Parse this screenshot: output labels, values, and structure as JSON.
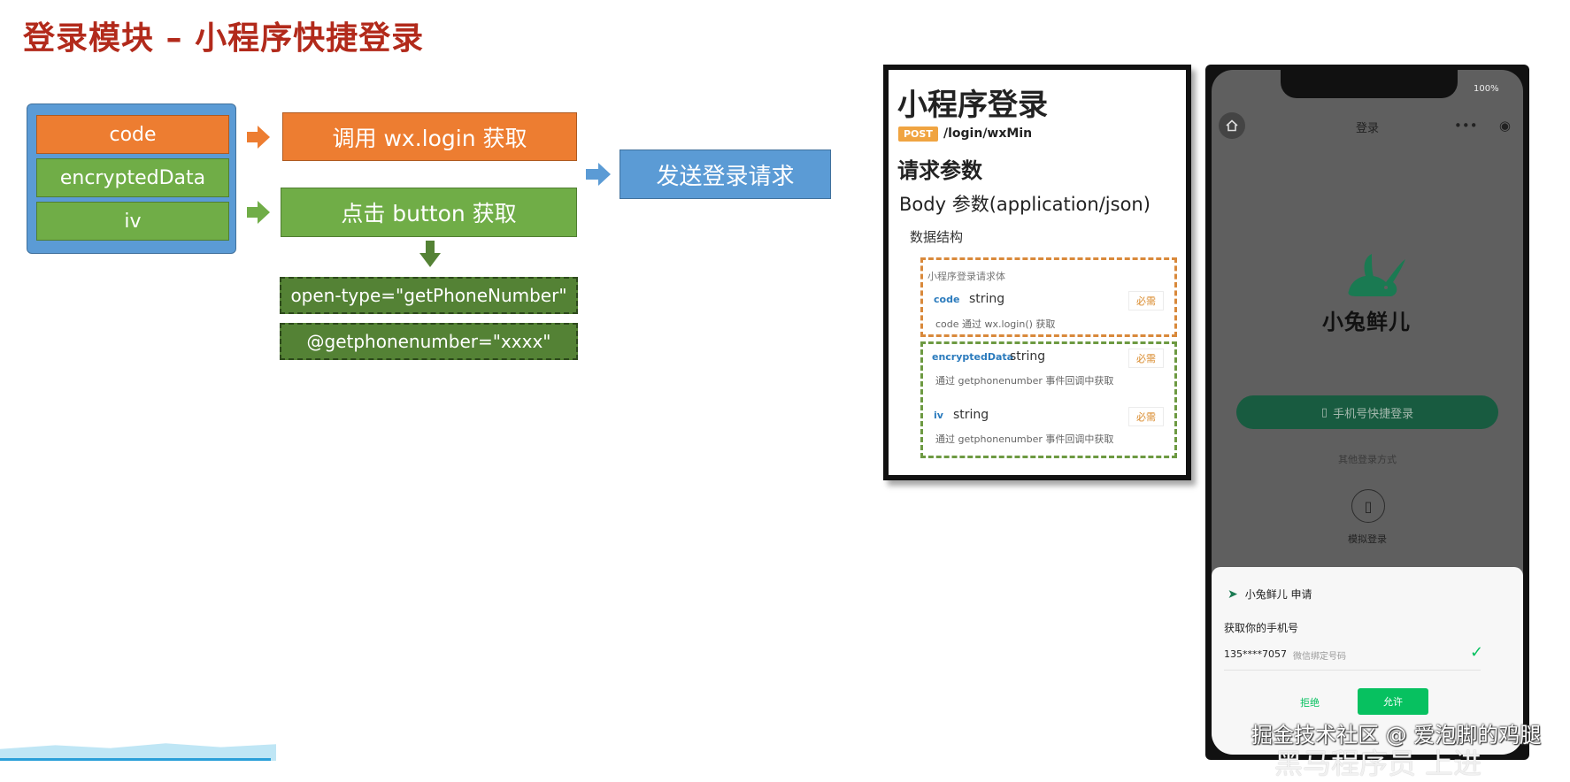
{
  "slide": {
    "title": "登录模块 – 小程序快捷登录"
  },
  "params": {
    "items": [
      "code",
      "encryptedData",
      "iv"
    ]
  },
  "flow": {
    "wx_login": "调用 wx.login 获取",
    "button_get": "点击 button 获取",
    "send_request": "发送登录请求",
    "open_type": "open-type=\"getPhoneNumber\"",
    "event_binding": "@getphonenumber=\"xxxx\""
  },
  "api_doc": {
    "title": "小程序登录",
    "method": "POST",
    "path": "/login/wxMin",
    "params_heading": "请求参数",
    "body_heading": "Body 参数(application/json)",
    "data_structure": "数据结构",
    "schema_name": "小程序登录请求体",
    "fields": [
      {
        "name": "code",
        "type": "string",
        "required": "必需",
        "desc": "code 通过 wx.login() 获取"
      },
      {
        "name": "encryptedData",
        "type": "string",
        "required": "必需",
        "desc": "通过 getphonenumber 事件回调中获取"
      },
      {
        "name": "iv",
        "type": "string",
        "required": "必需",
        "desc": "通过 getphonenumber 事件回调中获取"
      }
    ]
  },
  "phone": {
    "battery": "100%",
    "nav_title": "登录",
    "logo_text": "小兔鲜儿",
    "quick_login": "手机号快捷登录",
    "other_login": "其他登录方式",
    "sim_login": "模拟登录",
    "sheet": {
      "app_request": "小兔鲜儿 申请",
      "question": "获取你的手机号",
      "number": "135****7057",
      "number_note": "微信绑定号码",
      "reject": "拒绝",
      "allow": "允许"
    }
  },
  "watermark": "掘金技术社区 @ 爱泡脚的鸡腿",
  "ghost_text": "黑马程序员 上进",
  "colors": {
    "title_red": "#b22a1b",
    "orange": "#ed7d31",
    "green": "#70ad47",
    "blue": "#5b9bd5",
    "dark_green": "#548235",
    "wechat_green": "#07c160"
  }
}
